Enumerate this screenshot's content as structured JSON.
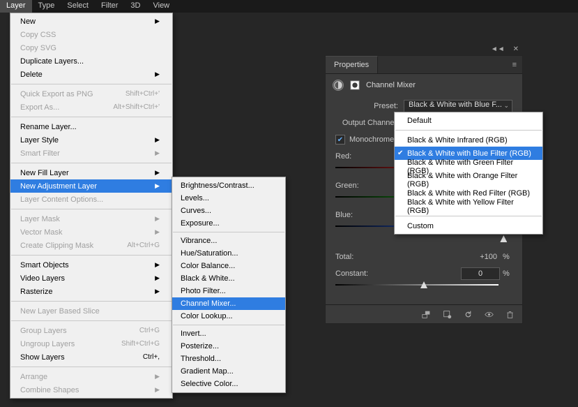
{
  "menubar": [
    "Layer",
    "Type",
    "Select",
    "Filter",
    "3D",
    "View"
  ],
  "layerMenu": [
    {
      "label": "New",
      "sub": true
    },
    {
      "label": "Copy CSS",
      "disabled": true
    },
    {
      "label": "Copy SVG",
      "disabled": true
    },
    {
      "label": "Duplicate Layers..."
    },
    {
      "label": "Delete",
      "sub": true
    },
    {
      "type": "sep"
    },
    {
      "label": "Quick Export as PNG",
      "accel": "Shift+Ctrl+'",
      "disabled": true
    },
    {
      "label": "Export As...",
      "accel": "Alt+Shift+Ctrl+'",
      "disabled": true
    },
    {
      "type": "sep"
    },
    {
      "label": "Rename Layer..."
    },
    {
      "label": "Layer Style",
      "sub": true
    },
    {
      "label": "Smart Filter",
      "sub": true,
      "disabled": true
    },
    {
      "type": "sep"
    },
    {
      "label": "New Fill Layer",
      "sub": true
    },
    {
      "label": "New Adjustment Layer",
      "sub": true,
      "hl": true
    },
    {
      "label": "Layer Content Options...",
      "disabled": true
    },
    {
      "type": "sep"
    },
    {
      "label": "Layer Mask",
      "sub": true,
      "disabled": true
    },
    {
      "label": "Vector Mask",
      "sub": true,
      "disabled": true
    },
    {
      "label": "Create Clipping Mask",
      "accel": "Alt+Ctrl+G",
      "disabled": true
    },
    {
      "type": "sep"
    },
    {
      "label": "Smart Objects",
      "sub": true
    },
    {
      "label": "Video Layers",
      "sub": true
    },
    {
      "label": "Rasterize",
      "sub": true
    },
    {
      "type": "sep"
    },
    {
      "label": "New Layer Based Slice",
      "disabled": true
    },
    {
      "type": "sep"
    },
    {
      "label": "Group Layers",
      "accel": "Ctrl+G",
      "disabled": true
    },
    {
      "label": "Ungroup Layers",
      "accel": "Shift+Ctrl+G",
      "disabled": true
    },
    {
      "label": "Show Layers",
      "accel": "Ctrl+,"
    },
    {
      "type": "sep"
    },
    {
      "label": "Arrange",
      "sub": true,
      "disabled": true
    },
    {
      "label": "Combine Shapes",
      "sub": true,
      "disabled": true
    }
  ],
  "subMenu": [
    {
      "label": "Brightness/Contrast..."
    },
    {
      "label": "Levels..."
    },
    {
      "label": "Curves..."
    },
    {
      "label": "Exposure..."
    },
    {
      "type": "sep"
    },
    {
      "label": "Vibrance..."
    },
    {
      "label": "Hue/Saturation..."
    },
    {
      "label": "Color Balance..."
    },
    {
      "label": "Black & White..."
    },
    {
      "label": "Photo Filter..."
    },
    {
      "label": "Channel Mixer...",
      "hl": true
    },
    {
      "label": "Color Lookup..."
    },
    {
      "type": "sep"
    },
    {
      "label": "Invert..."
    },
    {
      "label": "Posterize..."
    },
    {
      "label": "Threshold..."
    },
    {
      "label": "Gradient Map..."
    },
    {
      "label": "Selective Color..."
    }
  ],
  "panel": {
    "tab": "Properties",
    "title": "Channel Mixer",
    "presetLabel": "Preset:",
    "presetValue": "Black & White with Blue F...",
    "outputLabel": "Output Channel:",
    "monochrome": "Monochrome",
    "red": {
      "label": "Red:"
    },
    "green": {
      "label": "Green:"
    },
    "blue": {
      "label": "Blue:"
    },
    "total": {
      "label": "Total:",
      "value": "+100",
      "unit": "%"
    },
    "constant": {
      "label": "Constant:",
      "value": "0",
      "unit": "%"
    }
  },
  "dropdown": [
    {
      "label": "Default"
    },
    {
      "type": "sep"
    },
    {
      "label": "Black & White Infrared (RGB)"
    },
    {
      "label": "Black & White with Blue Filter (RGB)",
      "hl": true,
      "check": true
    },
    {
      "label": "Black & White with Green Filter (RGB)"
    },
    {
      "label": "Black & White with Orange Filter (RGB)"
    },
    {
      "label": "Black & White with Red Filter (RGB)"
    },
    {
      "label": "Black & White with Yellow Filter (RGB)"
    },
    {
      "type": "sep"
    },
    {
      "label": "Custom"
    }
  ]
}
